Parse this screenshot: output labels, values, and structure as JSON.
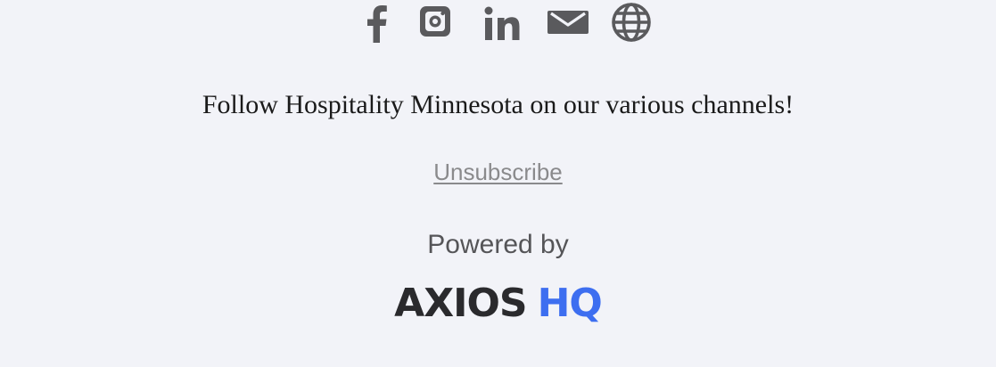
{
  "footer": {
    "social": [
      {
        "name": "facebook-icon"
      },
      {
        "name": "instagram-icon"
      },
      {
        "name": "linkedin-icon"
      },
      {
        "name": "email-icon"
      },
      {
        "name": "website-globe-icon"
      }
    ],
    "icon_color": "#5a5a5d",
    "follow_text": "Follow Hospitality Minnesota on our various channels!",
    "unsubscribe_label": "Unsubscribe",
    "powered_by": "Powered by",
    "logo": {
      "text_a": "AXIOS",
      "text_b": "HQ",
      "color_a": "#2a2a2d",
      "color_b": "#3d6ef0"
    }
  },
  "colors": {
    "background": "#f2f3f8",
    "link": "#8a8a8c",
    "text": "#1a1a1a"
  }
}
